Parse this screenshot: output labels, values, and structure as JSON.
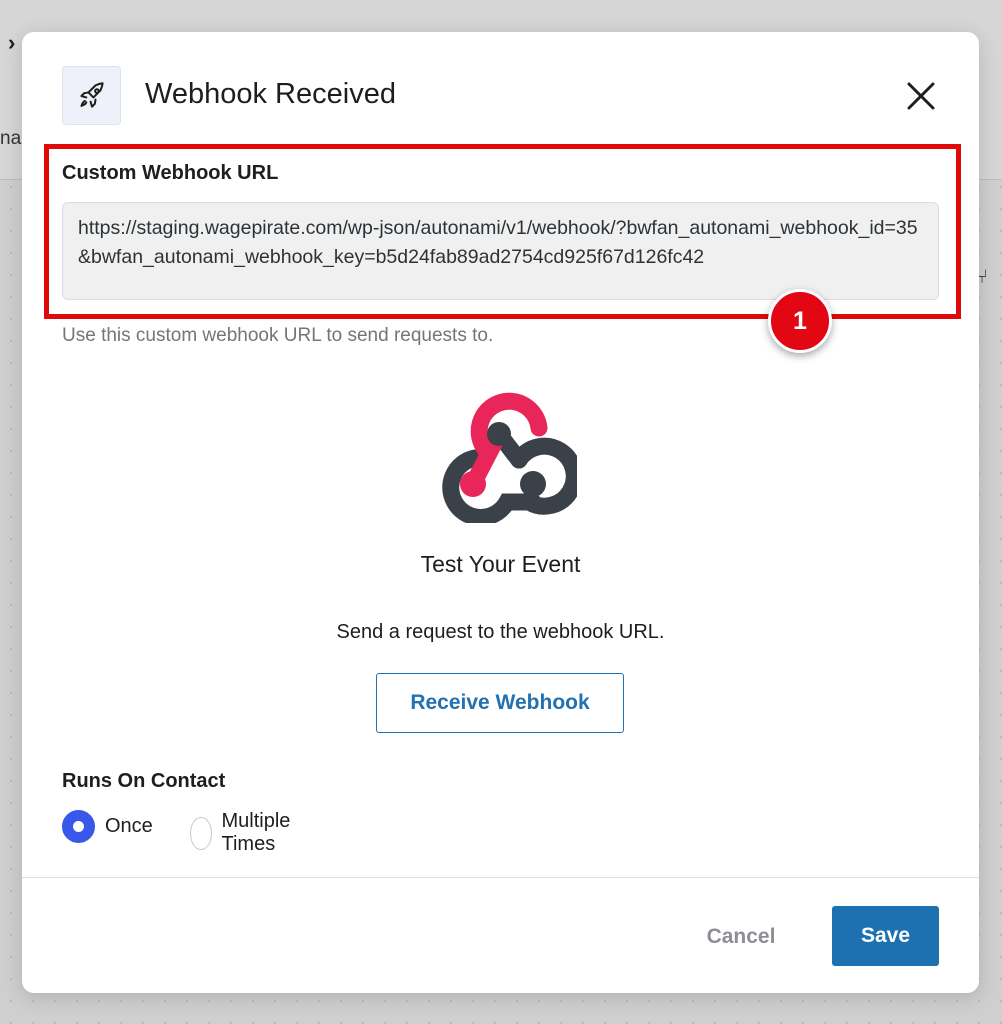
{
  "background": {
    "chevron_glyph": "›",
    "partial_text": "nal",
    "branch_glyph": "⑂"
  },
  "modal": {
    "title": "Webhook Received",
    "header_icon": "rocket-icon",
    "close_icon": "close-icon"
  },
  "webhook_url": {
    "label": "Custom Webhook URL",
    "value": "https://staging.wagepirate.com/wp-json/autonami/v1/webhook/?bwfan_autonami_webhook_id=35&bwfan_autonami_webhook_key=b5d24fab89ad2754cd925f67d126fc42",
    "help": "Use this custom webhook URL to send requests to.",
    "step_badge": "1"
  },
  "test": {
    "logo_icon": "webhook-icon",
    "title": "Test Your Event",
    "description": "Send a request to the webhook URL.",
    "button_label": "Receive Webhook"
  },
  "runs_on_contact": {
    "label": "Runs On Contact",
    "options": [
      {
        "label": "Once",
        "selected": true
      },
      {
        "label": "Multiple Times",
        "selected": false
      }
    ]
  },
  "footer": {
    "cancel_label": "Cancel",
    "save_label": "Save"
  },
  "colors": {
    "highlight": "#e10a0a",
    "primary": "#1d71b0",
    "radio_checked": "#3858e9",
    "logo_pink": "#e8265a",
    "logo_dark": "#3b4149"
  }
}
